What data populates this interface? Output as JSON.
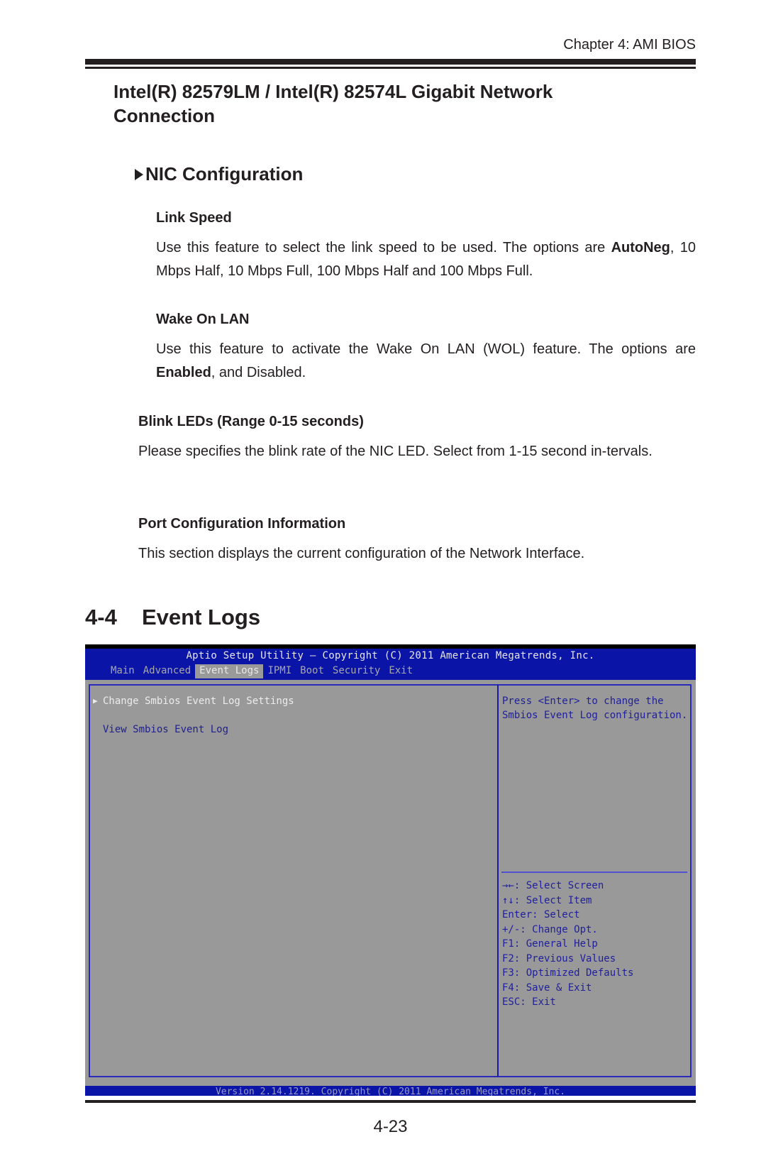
{
  "header": {
    "chapter": "Chapter 4: AMI BIOS"
  },
  "section": {
    "title": "Intel(R) 82579LM / Intel(R) 82574L Gigabit Network Connection",
    "nic_configuration": {
      "title": "NIC Configuration",
      "icon": "right-triangle-icon",
      "link_speed": {
        "heading": "Link Speed",
        "text_before": "Use this feature to select the link speed to be used. The options are ",
        "default": "AutoNeg",
        "text_after": ", 10 Mbps Half, 10 Mbps Full, 100 Mbps Half and 100 Mbps Full."
      },
      "wake_on_lan": {
        "heading": "Wake On LAN",
        "text_before": "Use this feature to activate the Wake On LAN (WOL) feature. The options are ",
        "default": "Enabled",
        "text_after": ", and Disabled."
      }
    },
    "blink_leds": {
      "heading": "Blink LEDs (Range 0-15 seconds)",
      "text": "Please specifies the blink rate of the NIC LED.  Select from 1-15 second in-tervals."
    },
    "port_config": {
      "heading": "Port Configuration Information",
      "text": "This section displays the current configuration of the Network Interface."
    }
  },
  "event_logs": {
    "number": "4-4",
    "title": "Event Logs"
  },
  "bios": {
    "title": "Aptio Setup Utility – Copyright (C) 2011 American Megatrends, Inc.",
    "tabs": [
      {
        "label": "Main",
        "active": false
      },
      {
        "label": "Advanced",
        "active": false
      },
      {
        "label": "Event Logs",
        "active": true
      },
      {
        "label": "IPMI",
        "active": false
      },
      {
        "label": "Boot",
        "active": false
      },
      {
        "label": "Security",
        "active": false
      },
      {
        "label": "Exit",
        "active": false
      }
    ],
    "menu_items": [
      {
        "label": "Change Smbios Event Log Settings",
        "selected": true,
        "submenu": true
      },
      {
        "label": "View Smbios Event Log",
        "selected": false,
        "submenu": false
      }
    ],
    "help_text": [
      "Press <Enter> to change the",
      "Smbios Event Log configuration."
    ],
    "keys": [
      "→←: Select Screen",
      "↑↓: Select Item",
      "Enter: Select",
      "+/-: Change Opt.",
      "F1: General Help",
      "F2: Previous Values",
      "F3: Optimized Defaults",
      "F4: Save & Exit",
      "ESC: Exit"
    ],
    "footer": "Version 2.14.1219. Copyright (C) 2011 American Megatrends, Inc.",
    "colors": {
      "header_blue": "#0a14a6",
      "panel_gray": "#999999",
      "help_text": "#20209a",
      "selected_text": "#ececec"
    }
  },
  "footer": {
    "page_number": "4-23"
  }
}
